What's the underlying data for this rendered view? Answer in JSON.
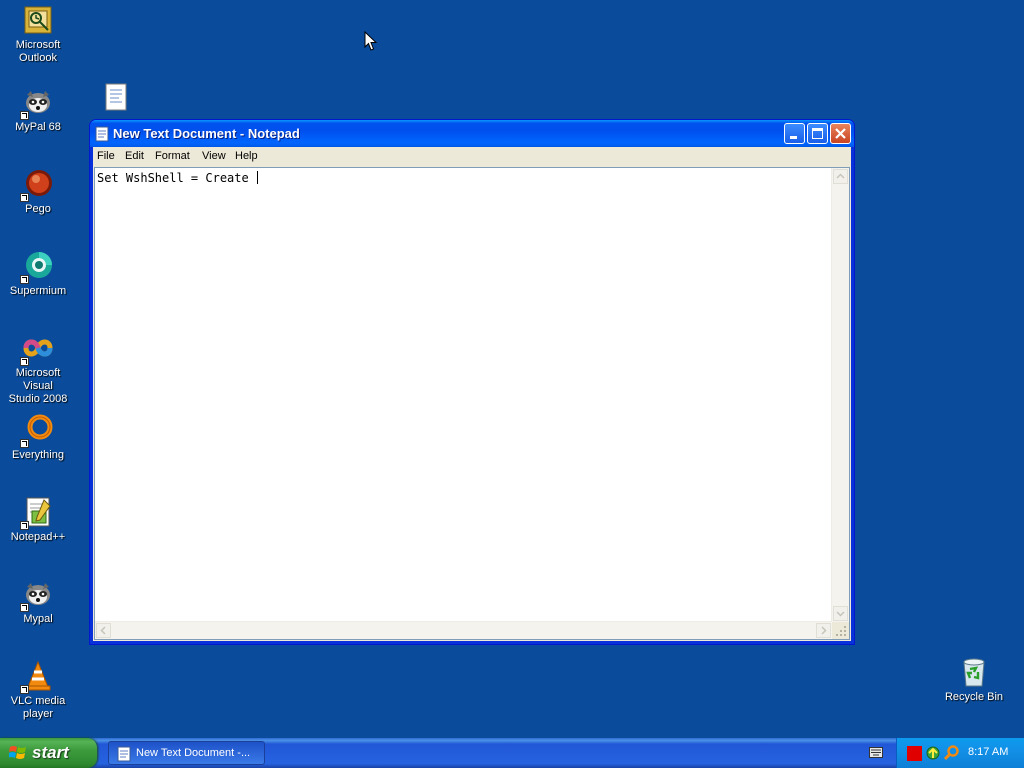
{
  "desktop": {
    "icons": [
      {
        "label": "Microsoft\nOutlook"
      },
      {
        "label": "MyPal 68"
      },
      {
        "label": "Pego"
      },
      {
        "label": "Supermium"
      },
      {
        "label": "Microsoft Visual\nStudio 2008"
      },
      {
        "label": "Everything"
      },
      {
        "label": "Notepad++"
      },
      {
        "label": "Mypal"
      },
      {
        "label": "VLC media\nplayer"
      },
      {
        "label": "Recycle Bin"
      }
    ]
  },
  "window": {
    "title": "New Text Document - Notepad",
    "menu": [
      "File",
      "Edit",
      "Format",
      "View",
      "Help"
    ],
    "content": "Set WshShell = Create "
  },
  "taskbar": {
    "start_label": "start",
    "task_label": "New Text Document -...",
    "clock": "8:17 AM"
  },
  "colors": {
    "desktop_bg": "#0a4c9b",
    "titlebar": "#0058e6",
    "start_green": "#3d9b3d",
    "tray_blue": "#0c9bec"
  }
}
